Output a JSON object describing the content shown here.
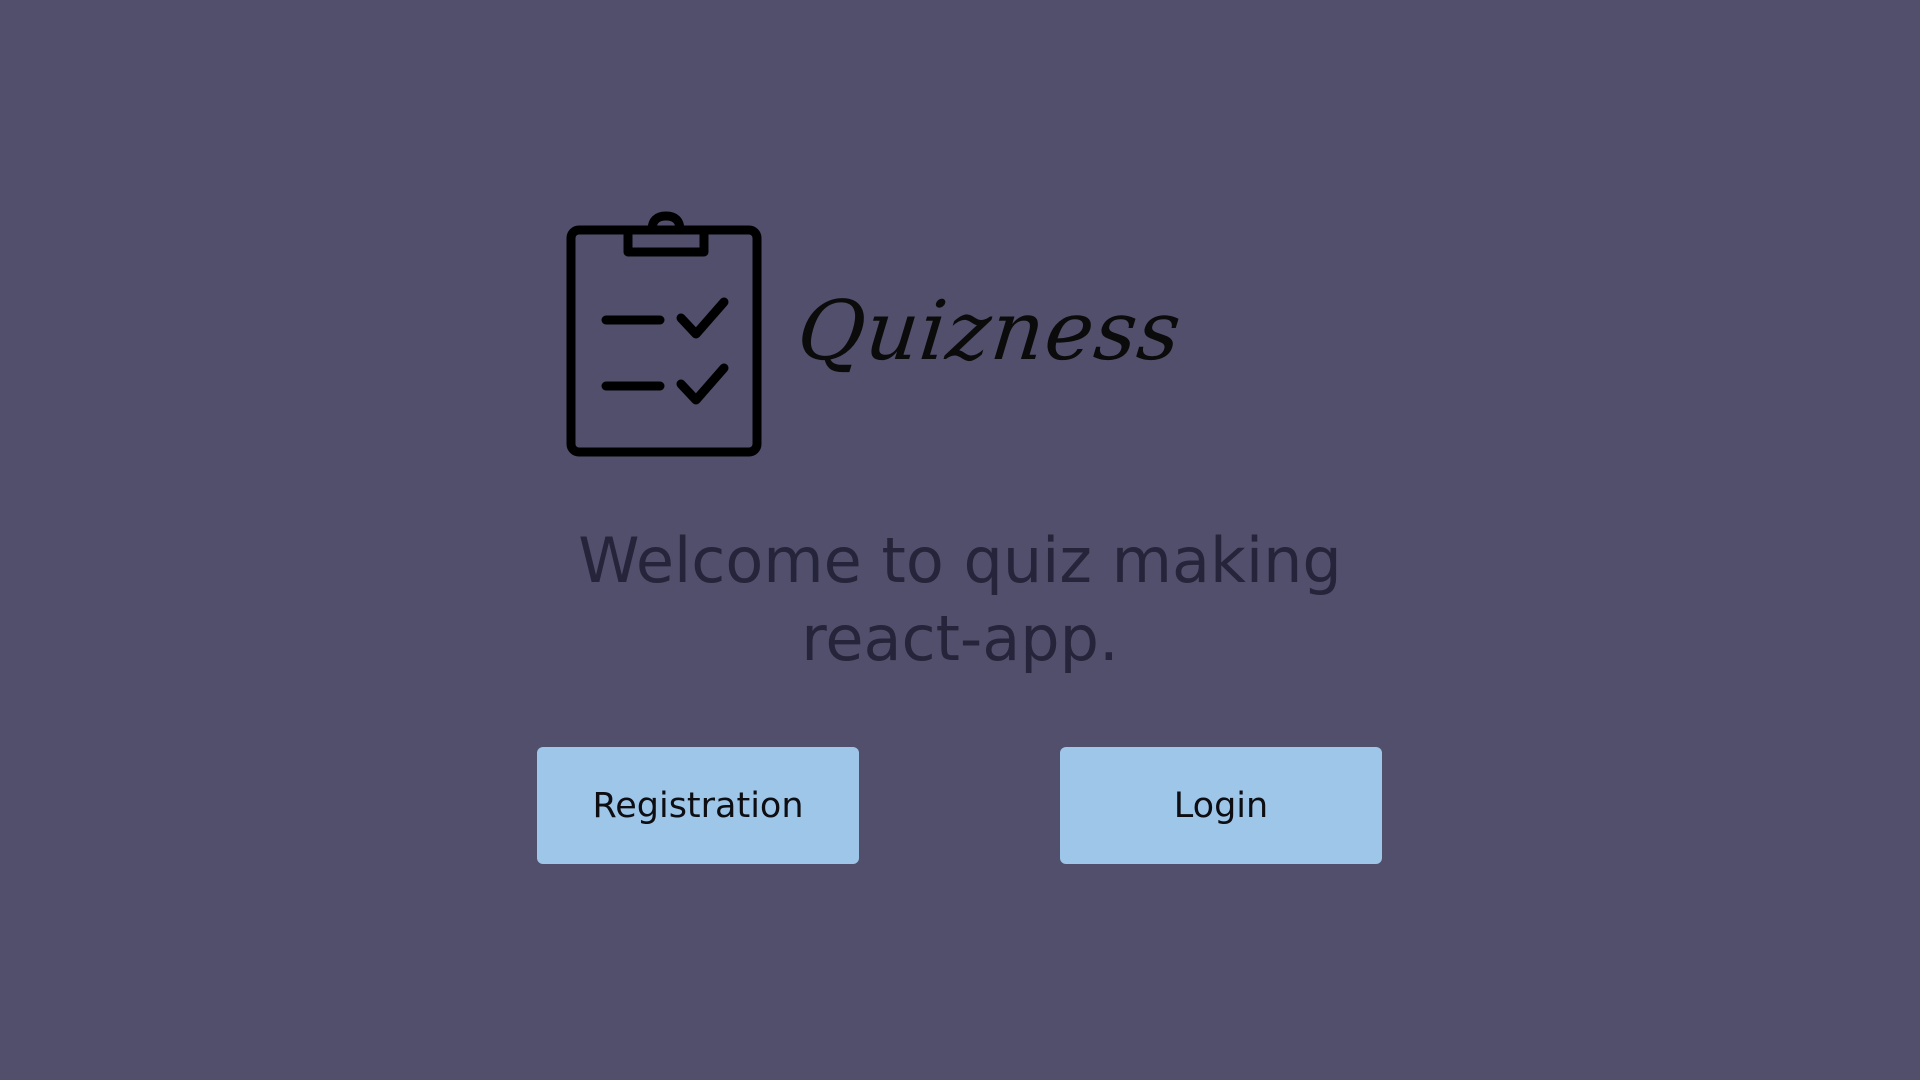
{
  "brand": {
    "name": "Quizness",
    "icon": "clipboard-checklist-icon"
  },
  "welcome": {
    "line1": "Welcome to quiz making",
    "line2": "react-app."
  },
  "actions": {
    "registration_label": "Registration",
    "login_label": "Login"
  },
  "colors": {
    "background": "#514f6b",
    "button": "#9dc6e8",
    "heading": "#26243a"
  }
}
